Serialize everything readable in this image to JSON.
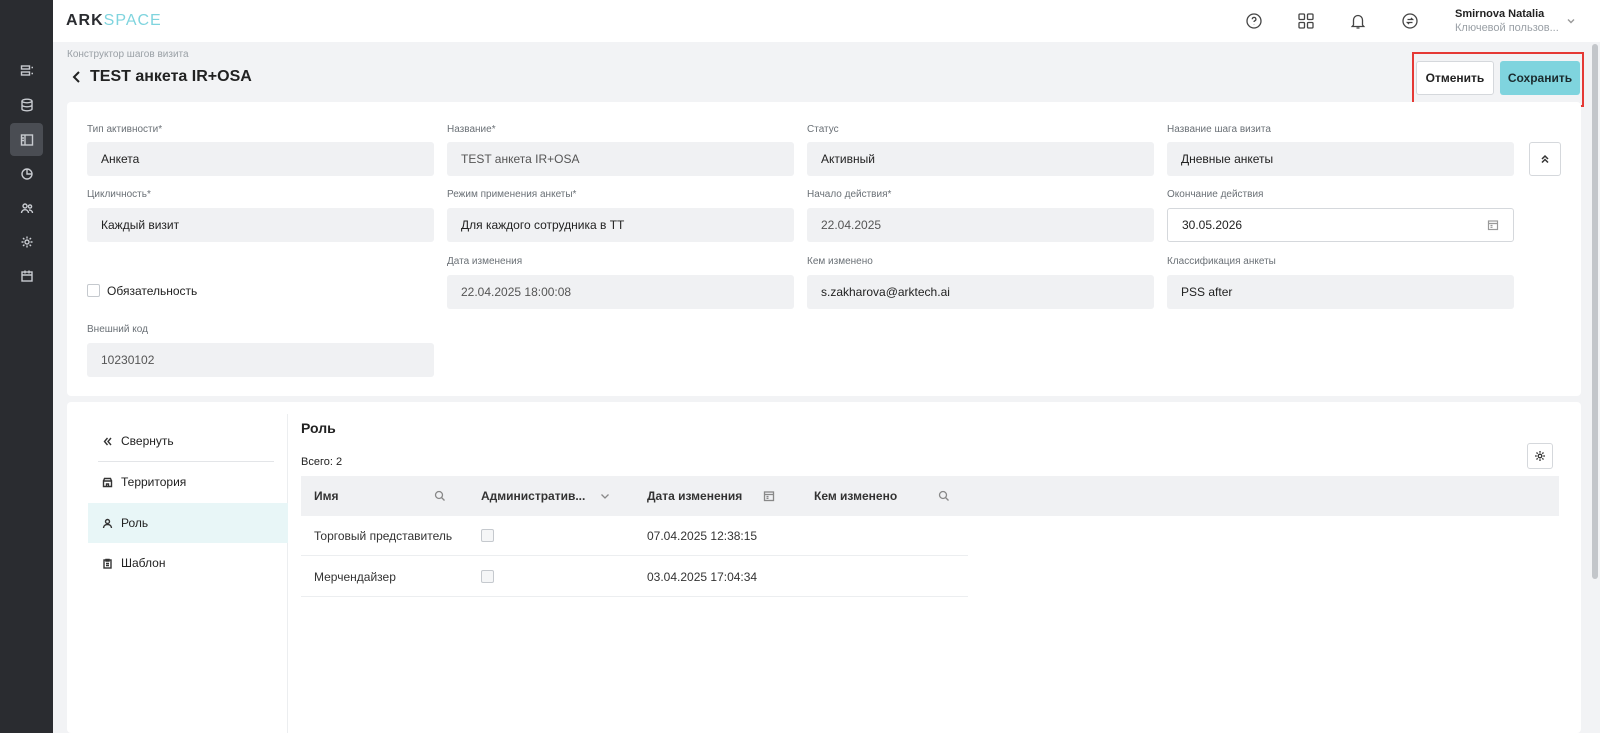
{
  "logo": {
    "part1": "ARK",
    "part2": "SPACE"
  },
  "header": {
    "icons": [
      "support-chat-icon",
      "apps-grid-icon",
      "bell-icon",
      "sync-icon"
    ],
    "user_name": "Smirnova Natalia",
    "user_role": "Ключевой пользов..."
  },
  "sidebar": {
    "items": [
      "tasks-icon",
      "database-icon",
      "layout-icon",
      "analytics-icon",
      "users-icon",
      "settings-icon",
      "calendar-icon"
    ],
    "active_index": 2
  },
  "breadcrumb": "Конструктор шагов визита",
  "page_title": "TEST анкета IR+OSA",
  "actions": {
    "cancel": "Отменить",
    "save": "Сохранить"
  },
  "form": {
    "activity_type": {
      "label": "Тип активности*",
      "value": "Анкета"
    },
    "name": {
      "label": "Название*",
      "value": "TEST анкета IR+OSA"
    },
    "status": {
      "label": "Статус",
      "value": "Активный"
    },
    "step_name": {
      "label": "Название шага визита",
      "value": "Дневные анкеты"
    },
    "cyclicity": {
      "label": "Цикличность*",
      "value": "Каждый визит"
    },
    "mode": {
      "label": "Режим применения анкеты*",
      "value": "Для каждого сотрудника в ТТ"
    },
    "start": {
      "label": "Начало действия*",
      "value": "22.04.2025"
    },
    "end": {
      "label": "Окончание действия",
      "value": "30.05.2026"
    },
    "mandatory": {
      "label": "Обязательность",
      "checked": false
    },
    "modified_date": {
      "label": "Дата изменения",
      "value": "22.04.2025 18:00:08"
    },
    "modified_by": {
      "label": "Кем изменено",
      "value": "s.zakharova@arktech.ai"
    },
    "classification": {
      "label": "Классификация анкеты",
      "value": "PSS after"
    },
    "external_code": {
      "label": "Внешний код",
      "value": "10230102"
    }
  },
  "left_nav": {
    "collapse": "Свернуть",
    "items": [
      {
        "label": "Территория",
        "icon": "store-icon"
      },
      {
        "label": "Роль",
        "icon": "user-icon",
        "active": true
      },
      {
        "label": "Шаблон",
        "icon": "clipboard-icon"
      }
    ]
  },
  "role_section": {
    "title": "Роль",
    "total": "Всего: 2",
    "columns": [
      "Имя",
      "Административ...",
      "Дата изменения",
      "Кем изменено"
    ],
    "rows": [
      {
        "name": "Торговый представитель",
        "admin": false,
        "date": "07.04.2025 12:38:15",
        "by": ""
      },
      {
        "name": "Мерчендайзер",
        "admin": false,
        "date": "03.04.2025 17:04:34",
        "by": ""
      }
    ]
  }
}
